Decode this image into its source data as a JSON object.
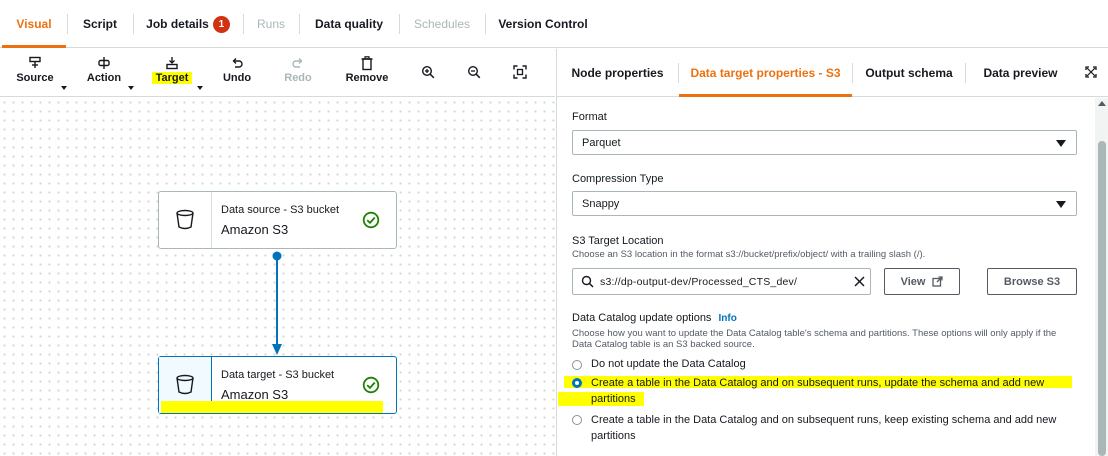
{
  "top_tabs": [
    {
      "label": "Visual"
    },
    {
      "label": "Script"
    },
    {
      "label": "Job details",
      "badge": "1"
    },
    {
      "label": "Runs"
    },
    {
      "label": "Data quality"
    },
    {
      "label": "Schedules"
    },
    {
      "label": "Version Control"
    }
  ],
  "toolbar": {
    "source": "Source",
    "action": "Action",
    "target": "Target",
    "undo": "Undo",
    "redo": "Redo",
    "remove": "Remove"
  },
  "nodes": {
    "source": {
      "type_label": "Data source - S3 bucket",
      "name": "Amazon S3"
    },
    "target": {
      "type_label": "Data target - S3 bucket",
      "name": "Amazon S3"
    }
  },
  "right_tabs": [
    {
      "label": "Node properties"
    },
    {
      "label": "Data target properties - S3"
    },
    {
      "label": "Output schema"
    },
    {
      "label": "Data preview"
    }
  ],
  "form": {
    "format_label": "Format",
    "format_value": "Parquet",
    "compression_label": "Compression Type",
    "compression_value": "Snappy",
    "s3_location_label": "S3 Target Location",
    "s3_location_desc": "Choose an S3 location in the format s3://bucket/prefix/object/ with a trailing slash (/).",
    "s3_location_value": "s3://dp-output-dev/Processed_CTS_dev/",
    "view_button": "View",
    "browse_button": "Browse S3",
    "catalog_label": "Data Catalog update options",
    "catalog_info": "Info",
    "catalog_desc_line1": "Choose how you want to update the Data Catalog table's schema and partitions. These options will only apply if the",
    "catalog_desc_line2": "Data Catalog table is an S3 backed source.",
    "options": [
      {
        "line1": "Do not update the Data Catalog",
        "line2": ""
      },
      {
        "line1": "Create a table in the Data Catalog and on subsequent runs, update the schema and add new",
        "line2": "partitions"
      },
      {
        "line1": "Create a table in the Data Catalog and on subsequent runs, keep existing schema and add new",
        "line2": "partitions"
      }
    ]
  },
  "colors": {
    "accent": "#ec7211",
    "link": "#0073bb",
    "highlight": "#ffff00",
    "success": "#1d8102",
    "badge": "#d13212"
  }
}
